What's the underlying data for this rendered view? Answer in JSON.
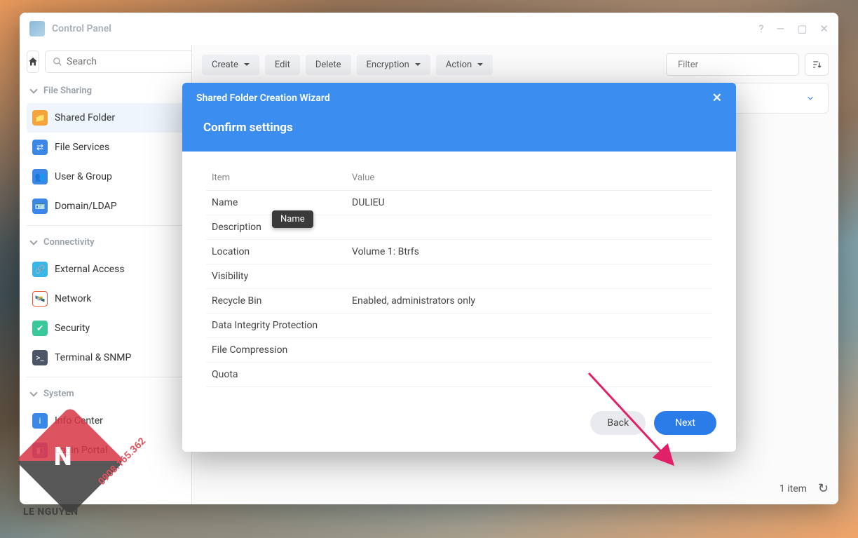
{
  "window": {
    "title": "Control Panel"
  },
  "search": {
    "placeholder": "Search"
  },
  "sidebar": {
    "sections": {
      "file_sharing": "File Sharing",
      "connectivity": "Connectivity",
      "system": "System"
    },
    "items": {
      "shared_folder": "Shared Folder",
      "file_services": "File Services",
      "user_group": "User & Group",
      "domain_ldap": "Domain/LDAP",
      "external_access": "External Access",
      "network": "Network",
      "security": "Security",
      "terminal_snmp": "Terminal & SNMP",
      "info_center": "Info Center",
      "login_portal": "Login Portal"
    }
  },
  "toolbar": {
    "create": "Create",
    "edit": "Edit",
    "delete": "Delete",
    "encryption": "Encryption",
    "action": "Action",
    "filter_placeholder": "Filter"
  },
  "status": {
    "count": "1 item"
  },
  "wizard": {
    "title": "Shared Folder Creation Wizard",
    "heading": "Confirm settings",
    "table": {
      "col_item": "Item",
      "col_value": "Value",
      "rows": [
        {
          "item": "Name",
          "value": "DULIEU"
        },
        {
          "item": "Description",
          "value": ""
        },
        {
          "item": "Location",
          "value": "Volume 1: Btrfs"
        },
        {
          "item": "Visibility",
          "value": ""
        },
        {
          "item": "Recycle Bin",
          "value": "Enabled, administrators only"
        },
        {
          "item": "Data Integrity Protection",
          "value": ""
        },
        {
          "item": "File Compression",
          "value": ""
        },
        {
          "item": "Quota",
          "value": ""
        }
      ]
    },
    "tooltip": "Name",
    "back": "Back",
    "next": "Next"
  },
  "watermark": {
    "brand": "LE NGUYEN",
    "phone": "0908.165.362"
  }
}
